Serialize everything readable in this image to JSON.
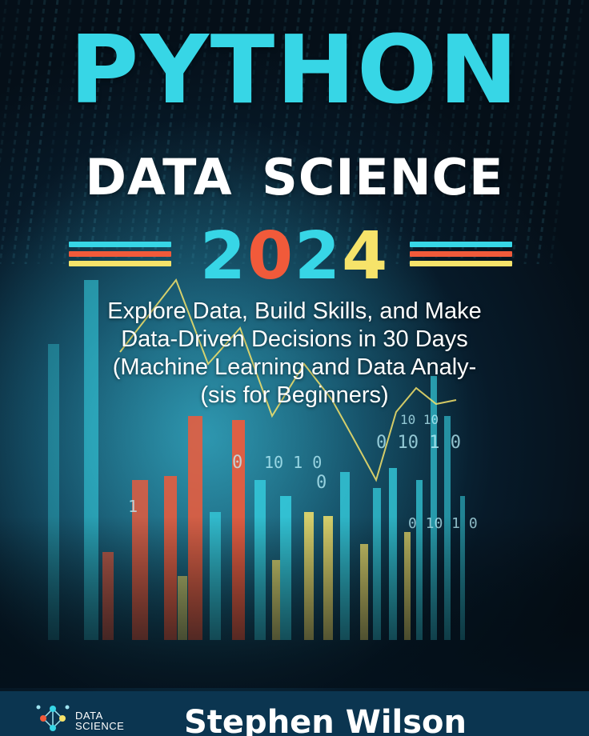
{
  "cover": {
    "title_line1": "PYTHON",
    "title_line2": "DATA SCIENCE",
    "year_digits": [
      {
        "char": "2",
        "color": "#37d6e6"
      },
      {
        "char": "0",
        "color": "#f15a3a"
      },
      {
        "char": "2",
        "color": "#37d6e6"
      },
      {
        "char": "4",
        "color": "#f6e36a"
      }
    ],
    "subtitle_lines": [
      "Explore Data, Build Skills, and Make",
      "Data-Driven Decisions in 30 Days",
      "(Machine Learning and Data Analy-",
      "(sis for Beginners)"
    ],
    "stripe_colors": [
      "#37d6e6",
      "#f15a3a",
      "#f6e36a"
    ],
    "background_digits": [
      "0",
      "10 1 0",
      "0 10 1 0",
      "10 10",
      "0 10 1 0",
      "1",
      "0"
    ],
    "publisher_logo_text": "DATA SCIENCE",
    "author": "Stephen Wilson"
  },
  "colors": {
    "title": "#37d6e6",
    "accent_red": "#f15a3a",
    "accent_yellow": "#f6e36a",
    "footer": "#0b3550"
  }
}
